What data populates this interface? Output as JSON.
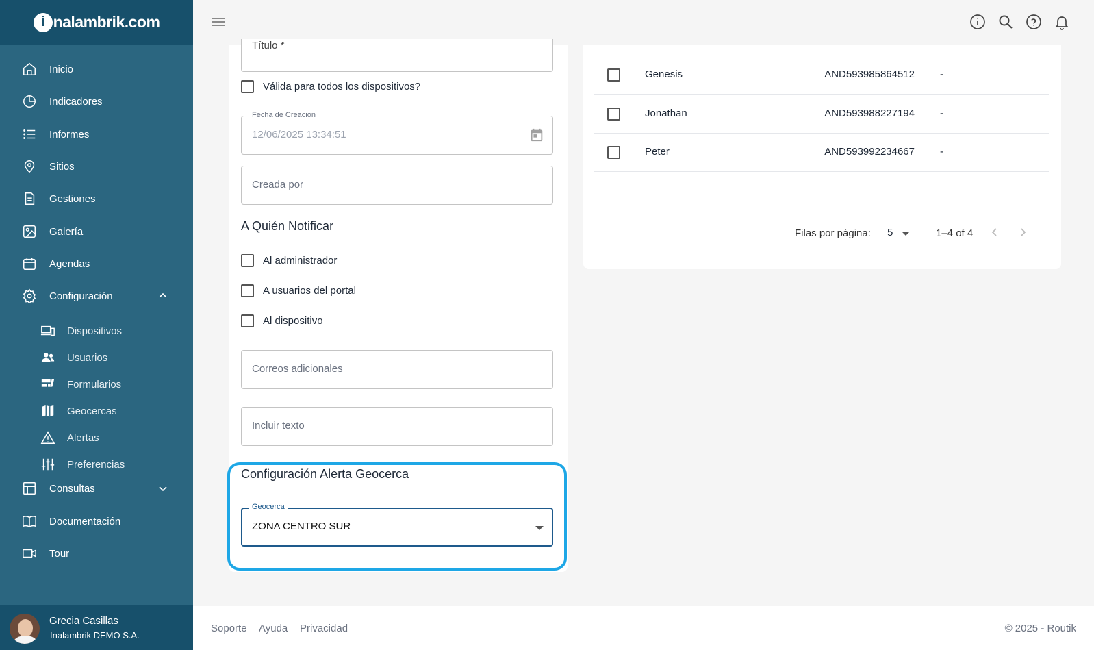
{
  "brand": {
    "logo_text": "nalambrik.com",
    "logo_letter": "i"
  },
  "sidebar": {
    "items": [
      {
        "label": "Inicio",
        "icon": "home-icon"
      },
      {
        "label": "Indicadores",
        "icon": "pie-chart-icon"
      },
      {
        "label": "Informes",
        "icon": "list-icon"
      },
      {
        "label": "Sitios",
        "icon": "location-pin-icon"
      },
      {
        "label": "Gestiones",
        "icon": "document-icon"
      },
      {
        "label": "Galería",
        "icon": "image-icon"
      },
      {
        "label": "Agendas",
        "icon": "calendar-icon"
      },
      {
        "label": "Configuración",
        "icon": "gear-icon"
      },
      {
        "label": "Consultas",
        "icon": "table-icon"
      },
      {
        "label": "Documentación",
        "icon": "book-icon"
      },
      {
        "label": "Tour",
        "icon": "video-camera-icon"
      }
    ],
    "sub_items": [
      {
        "label": "Dispositivos",
        "icon": "devices-icon"
      },
      {
        "label": "Usuarios",
        "icon": "users-icon"
      },
      {
        "label": "Formularios",
        "icon": "forms-icon"
      },
      {
        "label": "Geocercas",
        "icon": "map-icon"
      },
      {
        "label": "Alertas",
        "icon": "warning-icon"
      },
      {
        "label": "Preferencias",
        "icon": "sliders-icon"
      }
    ],
    "user": {
      "name": "Grecia Casillas",
      "org": "Inalambrik DEMO S.A."
    }
  },
  "form": {
    "titulo_label": "Título *",
    "valid_all_label": "Válida para todos los dispositivos?",
    "fecha_legend": "Fecha de Creación",
    "fecha_value": "12/06/2025 13:34:51",
    "creada_por_placeholder": "Creada por",
    "notify_title": "A Quién Notificar",
    "notify_options": [
      "Al administrador",
      "A usuarios del portal",
      "Al dispositivo"
    ],
    "correos_placeholder": "Correos adicionales",
    "incluir_placeholder": "Incluir texto",
    "geo_title": "Configuración Alerta Geocerca",
    "geocerca_legend": "Geocerca",
    "geocerca_value": "ZONA CENTRO SUR"
  },
  "table": {
    "rows": [
      {
        "name": "Genesis",
        "id": "AND593985864512",
        "extra": "-"
      },
      {
        "name": "Jonathan",
        "id": "AND593988227194",
        "extra": "-"
      },
      {
        "name": "Peter",
        "id": "AND593992234667",
        "extra": "-"
      }
    ],
    "rows_per_page_label": "Filas por página:",
    "rows_per_page_value": "5",
    "range": "1–4 of 4"
  },
  "footer": {
    "links": [
      "Soporte",
      "Ayuda",
      "Privacidad"
    ],
    "copyright": "© 2025 - Routik"
  },
  "colors": {
    "sidebar_bg": "#2b6680",
    "sidebar_dark": "#17506b",
    "highlight": "#1ea7e6",
    "focus": "#1e5a8c"
  }
}
